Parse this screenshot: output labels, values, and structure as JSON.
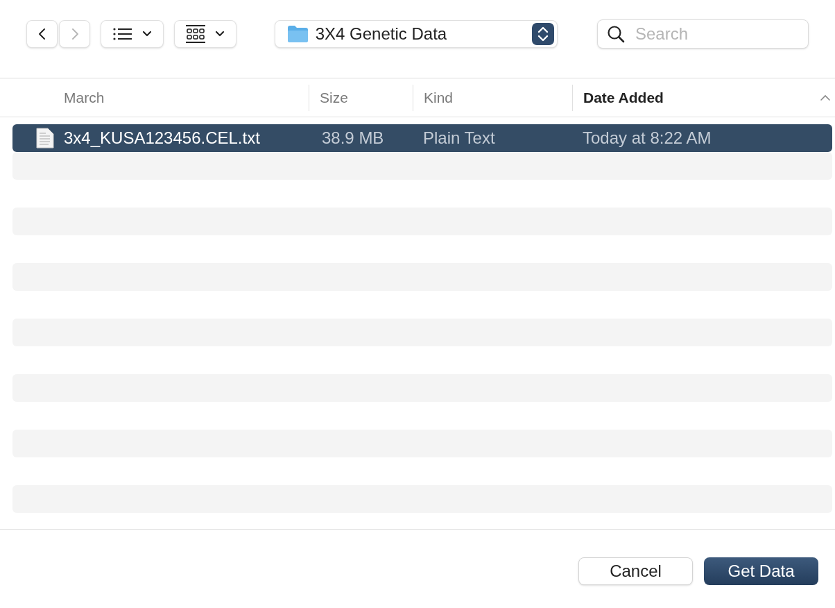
{
  "toolbar": {
    "back": {
      "disabled": false
    },
    "forward": {
      "disabled": true
    },
    "location": {
      "label": "3X4 Genetic Data"
    },
    "search": {
      "placeholder": "Search"
    }
  },
  "table": {
    "columns": [
      {
        "label": "March",
        "sorted": false
      },
      {
        "label": "Size",
        "sorted": false
      },
      {
        "label": "Kind",
        "sorted": false
      },
      {
        "label": "Date Added",
        "sorted": true
      }
    ],
    "rows": [
      {
        "name": "3x4_KUSA123456.CEL.txt",
        "size": "38.9 MB",
        "kind": "Plain Text",
        "date_added": "Today at 8:22 AM",
        "selected": true
      }
    ]
  },
  "buttons": [
    {
      "label": "Cancel",
      "kind": "secondary"
    },
    {
      "label": "Get Data",
      "kind": "primary"
    }
  ]
}
